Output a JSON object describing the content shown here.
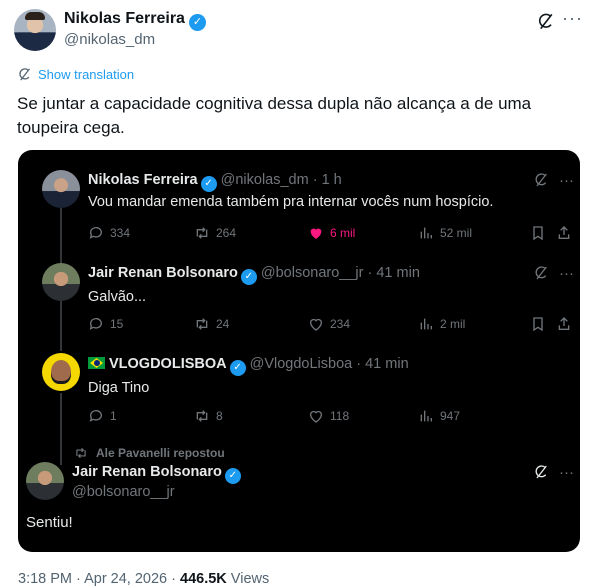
{
  "author": {
    "name": "Nikolas Ferreira",
    "handle": "@nikolas_dm"
  },
  "translate_label": "Show translation",
  "tweet_text": "Se juntar a capacidade cognitiva dessa dupla não alcança a de uma toupeira cega.",
  "embedded": {
    "posts": [
      {
        "name": "Nikolas Ferreira",
        "handle": "@nikolas_dm",
        "time": "· 1 h",
        "text": "Vou mandar emenda também pra internar vocês num hospício.",
        "replies": "334",
        "reposts": "264",
        "likes": "6 mil",
        "views": "52 mil"
      },
      {
        "name": "Jair Renan Bolsonaro",
        "handle": "@bolsonaro__jr",
        "time": "· 41 min",
        "text": "Galvão...",
        "replies": "15",
        "reposts": "24",
        "likes": "234",
        "views": "2 mil"
      },
      {
        "name": "VLOGDOLISBOA",
        "handle": "@VlogdoLisboa",
        "time": "· 41 min",
        "text": "Diga Tino",
        "replies": "1",
        "reposts": "8",
        "likes": "118",
        "views": "947"
      }
    ],
    "repost_label": "Ale Pavanelli repostou",
    "final_post": {
      "name": "Jair Renan Bolsonaro",
      "handle": "@bolsonaro__jr",
      "text": "Sentiu!"
    }
  },
  "footer": {
    "time": "3:18 PM · Apr 24, 2026 · ",
    "views_count": "446.5K",
    "views_label": " Views"
  },
  "colors": {
    "accent": "#1d9bf0",
    "like": "#f91880",
    "dark_bg": "#000000",
    "muted": "#71767b"
  }
}
